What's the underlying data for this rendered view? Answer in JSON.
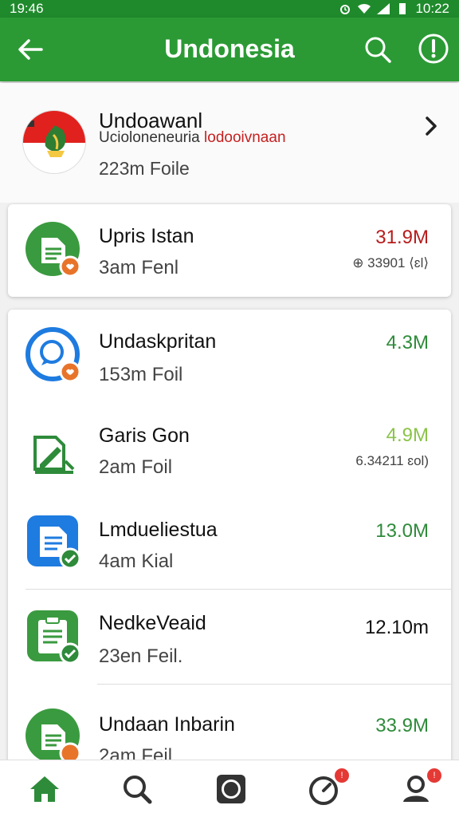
{
  "status_bar": {
    "time": "19:46",
    "right_text": "10:22",
    "icons": [
      "alarm-icon",
      "wifi-icon",
      "signal-icon",
      "battery-icon"
    ]
  },
  "app_bar": {
    "title": "Undonesia",
    "back_icon": "arrow-back-icon",
    "search_icon": "search-icon",
    "info_icon": "info-icon"
  },
  "header_item": {
    "title": "Undoawanl",
    "subtitle_black": "Ucioloneneuria",
    "subtitle_red": "lodooivnaan",
    "meta": "223m Foile",
    "icon": "indonesia-flag-icon"
  },
  "featured": {
    "name": "Upris Istan",
    "meta": "3am Fenl",
    "size": "31.9M",
    "size_color": "#b71c1c",
    "extra": "⊕ 33901 ⟨ɛl⟩",
    "icon": "green-document-icon"
  },
  "list": [
    {
      "name": "Undaskpritan",
      "meta": "153m Foil",
      "size": "4.3M",
      "size_color": "#2e8b3a",
      "extra": "",
      "icon": "blue-chat-icon"
    },
    {
      "name": "Garis Gon",
      "meta": "2am Foil",
      "size": "4.9M",
      "size_color": "#8bc34a",
      "extra": "6.34211 ɛol)",
      "icon": "green-edit-document-icon"
    },
    {
      "name": "Lmdueliestua",
      "meta": "4am Kial",
      "size": "13.0M",
      "size_color": "#2e8b3a",
      "extra": "",
      "icon": "blue-file-icon"
    },
    {
      "name": "NedkeVeaid",
      "meta": "23en Feil.",
      "size": "12.10m",
      "size_color": "#111111",
      "extra": "",
      "icon": "green-clipboard-icon"
    },
    {
      "name": "Undaan Inbarin",
      "meta": "2am Feil",
      "size": "33.9M",
      "size_color": "#2e8b3a",
      "extra": "",
      "icon": "green-document-icon"
    }
  ],
  "bottom_nav": [
    {
      "name": "home",
      "icon": "home-icon",
      "badge": ""
    },
    {
      "name": "search",
      "icon": "search-icon",
      "badge": ""
    },
    {
      "name": "stop",
      "icon": "stop-square-icon",
      "badge": ""
    },
    {
      "name": "timer",
      "icon": "timer-icon",
      "badge": "!"
    },
    {
      "name": "profile",
      "icon": "profile-icon",
      "badge": "!"
    }
  ],
  "colors": {
    "primary": "#2b9a35",
    "primary_dark": "#1f8a2c",
    "accent_orange": "#e8742a",
    "blue": "#1e7be0"
  }
}
